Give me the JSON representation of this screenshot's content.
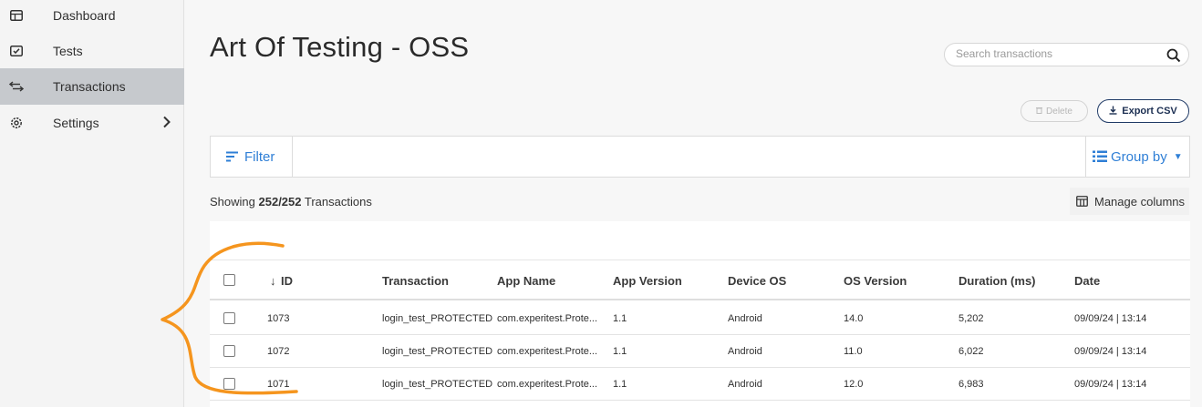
{
  "sidebar": {
    "items": [
      {
        "label": "Dashboard",
        "icon": "dashboard-icon"
      },
      {
        "label": "Tests",
        "icon": "tests-icon"
      },
      {
        "label": "Transactions",
        "icon": "transactions-icon",
        "active": true
      },
      {
        "label": "Settings",
        "icon": "gear-icon"
      }
    ]
  },
  "page": {
    "title": "Art Of Testing - OSS"
  },
  "search": {
    "placeholder": "Search transactions"
  },
  "toolbar": {
    "delete_label": "Delete",
    "export_label": "Export CSV"
  },
  "filter": {
    "filter_label": "Filter",
    "group_label": "Group by"
  },
  "summary": {
    "prefix": "Showing",
    "count": "252/252",
    "suffix": "Transactions",
    "manage_label": "Manage columns"
  },
  "table": {
    "columns": [
      "ID",
      "Transaction",
      "App Name",
      "App Version",
      "Device OS",
      "OS Version",
      "Duration (ms)",
      "Date"
    ],
    "sort_indicator": "↓",
    "rows": [
      [
        "1073",
        "login_test_PROTECTED",
        "com.experitest.Prote...",
        "1.1",
        "Android",
        "14.0",
        "5,202",
        "09/09/24 | 13:14"
      ],
      [
        "1072",
        "login_test_PROTECTED",
        "com.experitest.Prote...",
        "1.1",
        "Android",
        "11.0",
        "6,022",
        "09/09/24 | 13:14"
      ],
      [
        "1071",
        "login_test_PROTECTED",
        "com.experitest.Prote...",
        "1.1",
        "Android",
        "12.0",
        "6,983",
        "09/09/24 | 13:14"
      ]
    ]
  },
  "colors": {
    "accent": "#2f7fd6",
    "navy": "#1c2f52",
    "annotation": "#f5951e",
    "active_nav": "#c6c9cd"
  }
}
